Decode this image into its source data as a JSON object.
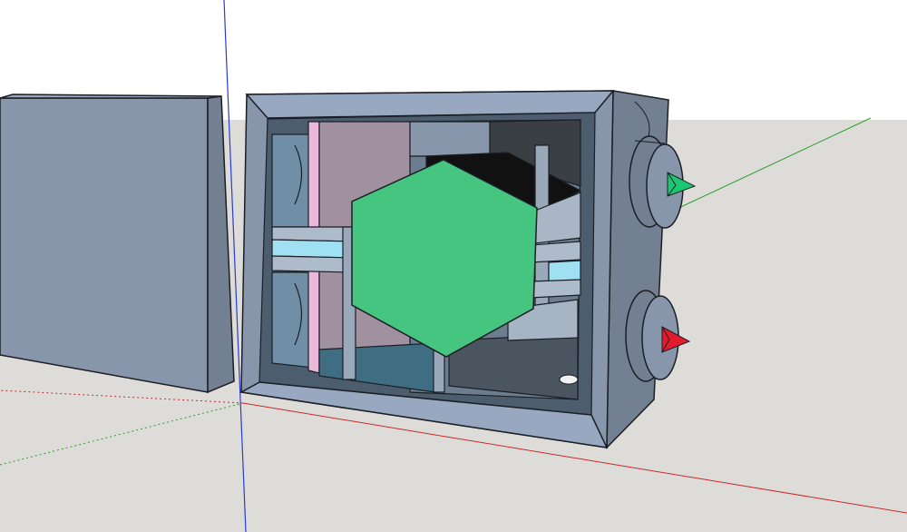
{
  "viewport": {
    "sky_color": "#ffffff",
    "ground_color": "#dedcd9",
    "axis_colors": {
      "red": "#cc2a2a",
      "green": "#2aa02a",
      "blue": "#2a3ccc"
    }
  },
  "model": {
    "housing_color": "#8796ab",
    "edge_color": "#1b1e24",
    "heat_exchanger_color": "#45c57f",
    "filter_pink_color": "#eab8d8",
    "filter_blue_color": "#9fe0f3",
    "duct_inner_color": "#6f8fa6",
    "arrow_outlet_color": "#19c871",
    "arrow_inlet_color": "#e31a2a"
  }
}
